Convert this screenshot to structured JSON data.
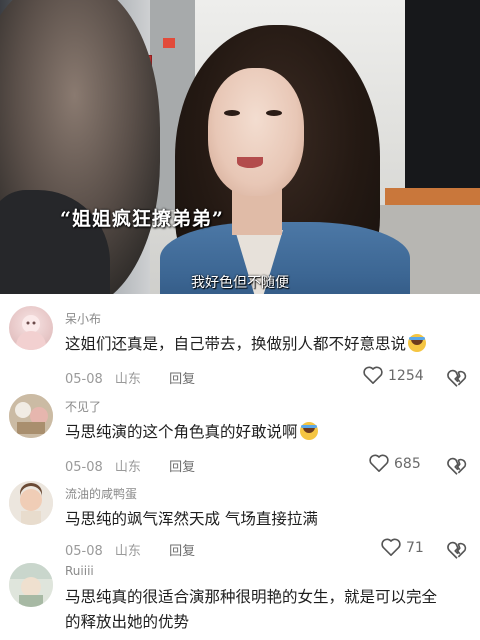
{
  "video": {
    "quote_caption": "“姐姐疯狂撩弟弟”",
    "subtitle": "我好色但不随便"
  },
  "comments": [
    {
      "username": "呆小布",
      "text": "这姐们还真是，自己带去，换做别人都不好意思说",
      "emoji": "laugh-cry-emoji",
      "date": "05-08",
      "location": "山东",
      "reply_label": "回复",
      "likes": "1254"
    },
    {
      "username": "不见了",
      "text": "马思纯演的这个角色真的好敢说啊",
      "emoji": "laugh-cry-emoji",
      "date": "05-08",
      "location": "山东",
      "reply_label": "回复",
      "likes": "685"
    },
    {
      "username": "流油的咸鸭蛋",
      "text": "马思纯的飒气浑然天成 气场直接拉满",
      "date": "05-08",
      "location": "山东",
      "reply_label": "回复",
      "likes": "71"
    },
    {
      "username": "Ruiiii",
      "text_line1": "马思纯真的很适合演那种很明艳的女生，就是可以完全",
      "text_line2": "的释放出她的优势"
    }
  ],
  "icons": {
    "like": "heart-outline-icon",
    "dislike": "broken-heart-icon"
  },
  "colors": {
    "username": "#8a8a8a",
    "meta": "#9a9a9a",
    "text": "#1e1e1e"
  }
}
